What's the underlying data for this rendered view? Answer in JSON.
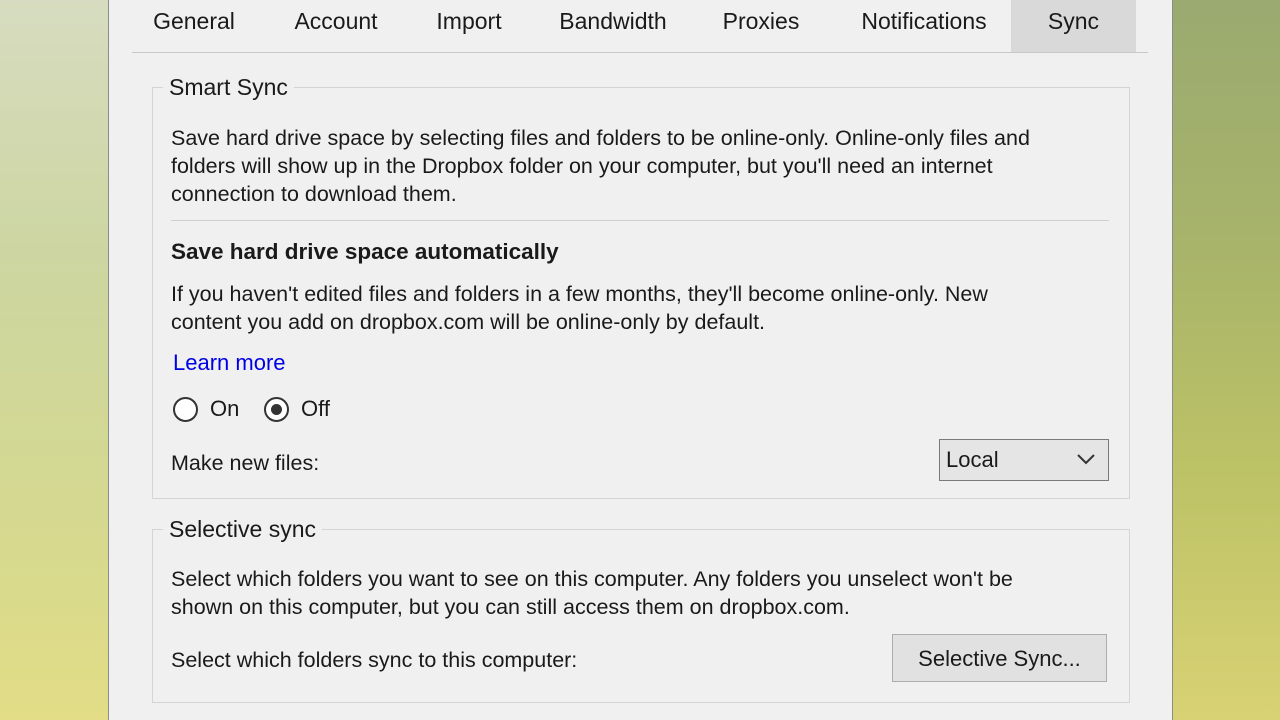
{
  "tabs": [
    {
      "label": "General",
      "active": false
    },
    {
      "label": "Account",
      "active": false
    },
    {
      "label": "Import",
      "active": false
    },
    {
      "label": "Bandwidth",
      "active": false
    },
    {
      "label": "Proxies",
      "active": false
    },
    {
      "label": "Notifications",
      "active": false
    },
    {
      "label": "Sync",
      "active": true
    }
  ],
  "smart_sync": {
    "title": "Smart Sync",
    "description": [
      "Save hard drive space by selecting files and folders to be online-only. Online-only files and",
      "folders will show up in the Dropbox folder on your computer, but you'll need an internet",
      "connection to download them."
    ],
    "auto_heading": "Save hard drive space automatically",
    "auto_description": [
      "If you haven't edited files and folders in a few months, they'll become online-only. New",
      "content you add on dropbox.com will be online-only by default."
    ],
    "learn_more": "Learn more",
    "radio_on": "On",
    "radio_off": "Off",
    "selected": "Off",
    "make_new_files_label": "Make new files:",
    "make_new_files_value": "Local"
  },
  "selective_sync": {
    "title": "Selective sync",
    "description": [
      "Select which folders you want to see on this computer. Any folders you unselect won't be",
      "shown on this computer, but you can still access them on dropbox.com."
    ],
    "prompt": "Select which folders sync to this computer:",
    "button_label": "Selective Sync..."
  },
  "colors": {
    "link": "#0000e6",
    "active_tab": "#d9d9d9",
    "dialog_bg": "#f0f0f0"
  }
}
